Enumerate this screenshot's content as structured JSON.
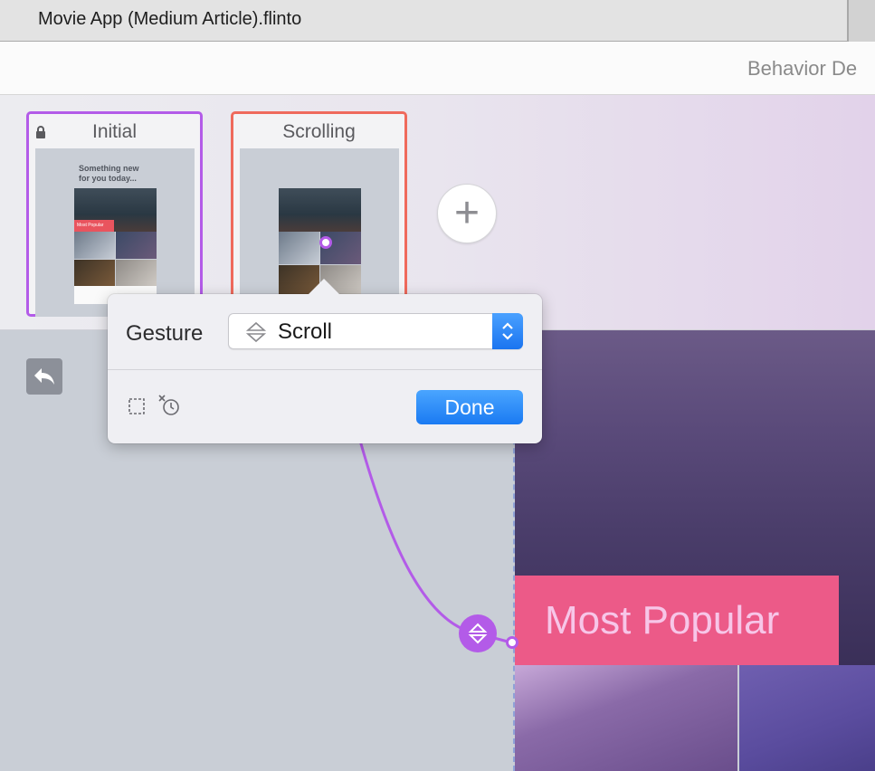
{
  "window": {
    "title": "Movie App (Medium Article).flinto"
  },
  "toolbar": {
    "section_title": "Behavior De"
  },
  "screens": [
    {
      "name": "Initial",
      "locked": true,
      "preview_greeting": "Something new for you today...",
      "preview_badge": "Most Popular"
    },
    {
      "name": "Scrolling",
      "locked": false
    }
  ],
  "popover": {
    "gesture_label": "Gesture",
    "gesture_value": "Scroll",
    "done_label": "Done"
  },
  "preview": {
    "section_label": "Most Popular"
  },
  "colors": {
    "accent": "#b35be8",
    "selected_screen": "#ef6a5c",
    "primary_button": "#1a7af2",
    "badge": "#ec5a88"
  }
}
